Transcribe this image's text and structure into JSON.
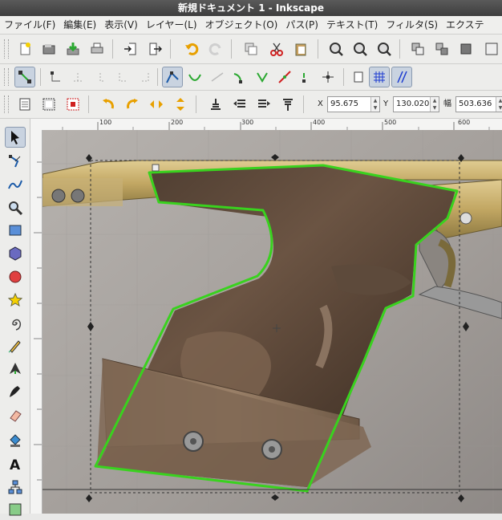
{
  "window": {
    "title": "新規ドキュメント 1 - Inkscape"
  },
  "menu": {
    "file": "ファイル(F)",
    "edit": "編集(E)",
    "view": "表示(V)",
    "layer": "レイヤー(L)",
    "object": "オブジェクト(O)",
    "path": "パス(P)",
    "text": "テキスト(T)",
    "filters": "フィルタ(S)",
    "extensions": "エクステ"
  },
  "selector_toolbar": {
    "x_label": "X",
    "x_value": "95.675",
    "y_label": "Y",
    "y_value": "130.020",
    "w_label": "幅",
    "w_value": "503.636"
  },
  "ruler": {
    "h_ticks": [
      "100",
      "200",
      "300",
      "400",
      "500",
      "600"
    ]
  },
  "icons": {
    "accent": "#2aa830",
    "handle": "#333333"
  },
  "colors": {
    "path_stroke": "#39d21e",
    "wood": "#5b4535",
    "brass": "#c2a763"
  }
}
